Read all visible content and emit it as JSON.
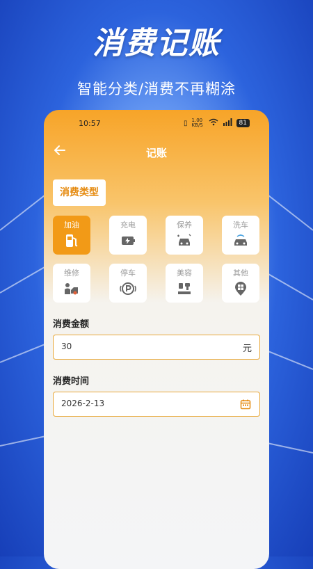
{
  "promo": {
    "headline": "消费记账",
    "subline": "智能分类/消费不再糊涂"
  },
  "status_bar": {
    "time": "10:57",
    "network_speed": "1.00 KB/S",
    "battery": "81"
  },
  "nav": {
    "title": "记账"
  },
  "expense_type": {
    "label": "消费类型",
    "categories": [
      {
        "label": "加油",
        "icon": "fuel-pump-icon",
        "selected": true
      },
      {
        "label": "充电",
        "icon": "battery-charge-icon",
        "selected": false
      },
      {
        "label": "保养",
        "icon": "car-maintenance-icon",
        "selected": false
      },
      {
        "label": "洗车",
        "icon": "car-wash-icon",
        "selected": false
      },
      {
        "label": "维修",
        "icon": "repair-icon",
        "selected": false
      },
      {
        "label": "停车",
        "icon": "parking-icon",
        "selected": false
      },
      {
        "label": "美容",
        "icon": "car-beauty-icon",
        "selected": false
      },
      {
        "label": "其他",
        "icon": "other-pin-icon",
        "selected": false
      }
    ]
  },
  "amount": {
    "label": "消费金额",
    "value": "30",
    "unit": "元"
  },
  "date": {
    "label": "消费时间",
    "value": "2026-2-13"
  },
  "colors": {
    "accent": "#f29a17",
    "background_blue": "#2c63dd"
  }
}
